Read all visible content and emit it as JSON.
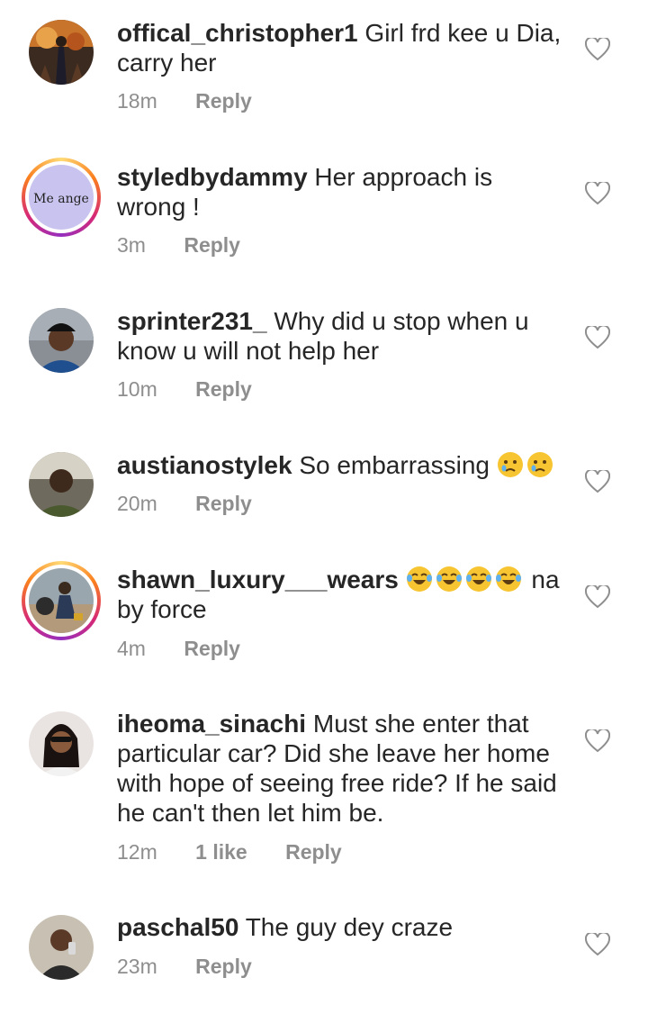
{
  "comments": [
    {
      "username": "offical_christopher1",
      "text": "Girl frd kee u Dia, carry her",
      "time": "18m",
      "likes": "",
      "reply": "Reply"
    },
    {
      "username": "styledbydammy",
      "text": "Her approach is wrong !",
      "time": "3m",
      "likes": "",
      "reply": "Reply",
      "avatar_text": "Me ange"
    },
    {
      "username": "sprinter231_",
      "text": "Why did u stop when u know u will not help her",
      "time": "10m",
      "likes": "",
      "reply": "Reply"
    },
    {
      "username": "austianostylek",
      "text": "So embarrassing",
      "emoji": [
        "crying-face",
        "crying-face"
      ],
      "time": "20m",
      "likes": "",
      "reply": "Reply"
    },
    {
      "username": "shawn_luxury___wears",
      "text_after_emoji": "na by force",
      "emoji": [
        "tears-of-joy",
        "tears-of-joy",
        "tears-of-joy",
        "tears-of-joy"
      ],
      "time": "4m",
      "likes": "",
      "reply": "Reply"
    },
    {
      "username": "iheoma_sinachi",
      "text": "Must she enter that particular car? Did she leave her home with hope of seeing free ride? If he said he can't then let him be.",
      "time": "12m",
      "likes": "1 like",
      "reply": "Reply"
    },
    {
      "username": "paschal50",
      "text": "The guy dey craze",
      "time": "23m",
      "likes": "",
      "reply": "Reply"
    }
  ]
}
